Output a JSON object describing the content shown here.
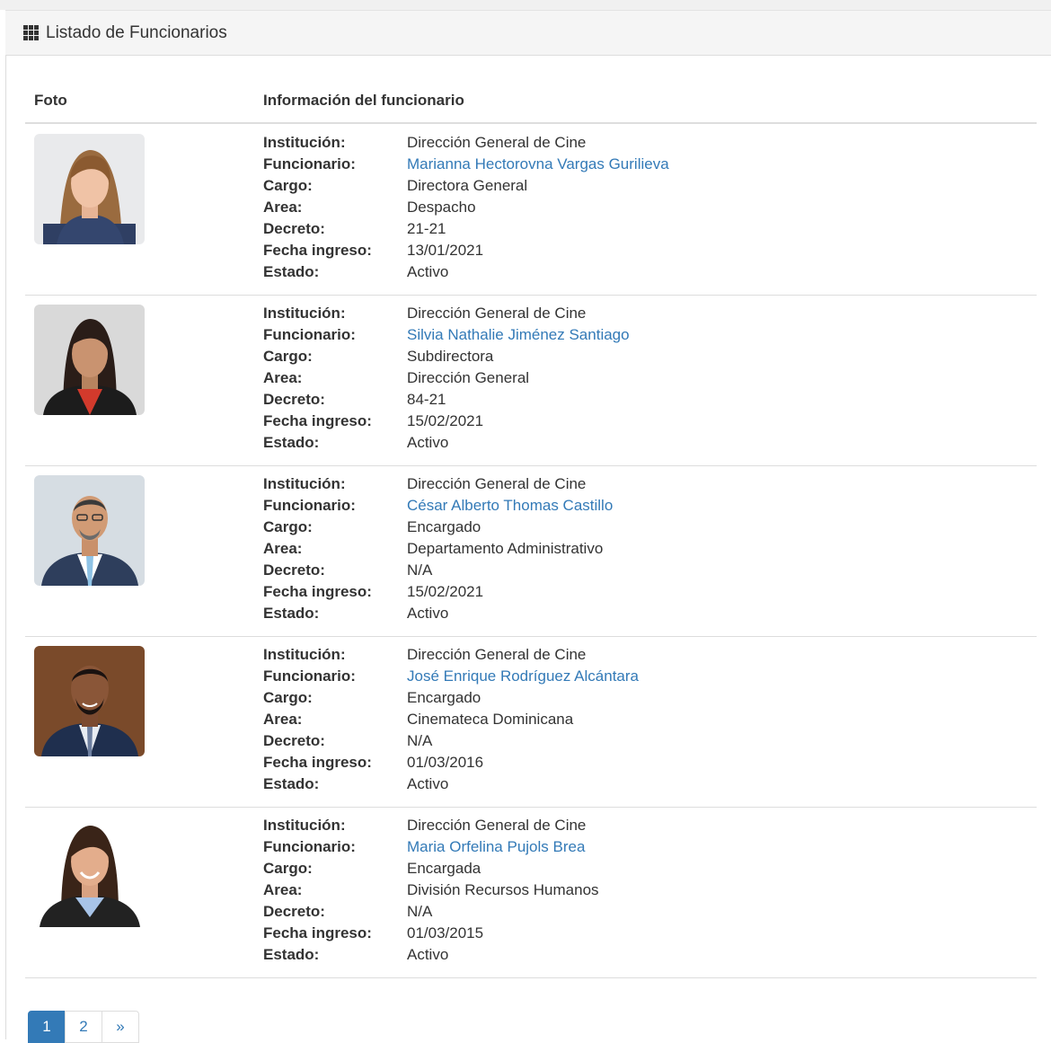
{
  "panel": {
    "title": "Listado de Funcionarios",
    "icon": "grid-icon"
  },
  "table": {
    "headers": [
      "Foto",
      "Información del funcionario"
    ],
    "field_labels": {
      "institucion": "Institución:",
      "funcionario": "Funcionario:",
      "cargo": "Cargo:",
      "area": "Area:",
      "decreto": "Decreto:",
      "fecha": "Fecha ingreso:",
      "estado": "Estado:"
    },
    "rows": [
      {
        "institucion": "Dirección General de Cine",
        "funcionario": "Marianna Hectorovna Vargas Gurilieva",
        "cargo": "Directora General",
        "area": "Despacho",
        "decreto": "21-21",
        "fecha": "13/01/2021",
        "estado": "Activo"
      },
      {
        "institucion": "Dirección General de Cine",
        "funcionario": "Silvia Nathalie Jiménez Santiago",
        "cargo": "Subdirectora",
        "area": "Dirección General",
        "decreto": "84-21",
        "fecha": "15/02/2021",
        "estado": "Activo"
      },
      {
        "institucion": "Dirección General de Cine",
        "funcionario": "César Alberto Thomas Castillo",
        "cargo": "Encargado",
        "area": "Departamento Administrativo",
        "decreto": "N/A",
        "fecha": "15/02/2021",
        "estado": "Activo"
      },
      {
        "institucion": "Dirección General de Cine",
        "funcionario": "José Enrique Rodríguez Alcántara",
        "cargo": "Encargado",
        "area": "Cinemateca Dominicana",
        "decreto": "N/A",
        "fecha": "01/03/2016",
        "estado": "Activo"
      },
      {
        "institucion": "Dirección General de Cine",
        "funcionario": "Maria Orfelina Pujols Brea",
        "cargo": "Encargada",
        "area": "División Recursos Humanos",
        "decreto": "N/A",
        "fecha": "01/03/2015",
        "estado": "Activo"
      }
    ]
  },
  "pagination": {
    "pages": [
      "1",
      "2"
    ],
    "active": "1",
    "next": "»"
  },
  "colors": {
    "link": "#337ab7",
    "text": "#333333",
    "border": "#dddddd",
    "heading_bg": "#f5f5f5"
  }
}
